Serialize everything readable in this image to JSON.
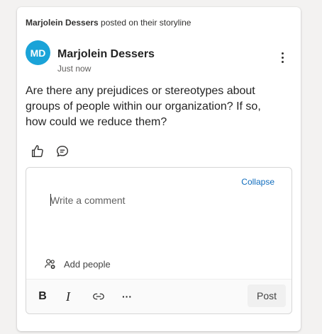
{
  "post": {
    "header_name": "Marjolein Dessers",
    "header_suffix": " posted on their storyline",
    "avatar_initials": "MD",
    "avatar_color": "#1aa3d8",
    "author_name": "Marjolein Dessers",
    "timestamp": "Just now",
    "body": "Are there any prejudices or stereotypes about groups of people within our organization? If so, how could we reduce them?",
    "icons": {
      "more": "more-vertical-icon",
      "like": "thumbs-up-icon",
      "comment": "comment-icon"
    }
  },
  "composer": {
    "collapse_label": "Collapse",
    "placeholder": "Write a comment",
    "add_people_label": "Add people",
    "add_people_icon": "add-people-icon",
    "toolbar": {
      "bold_label": "B",
      "italic_label": "I",
      "link_icon": "link-icon",
      "more_label": "···",
      "post_label": "Post"
    }
  },
  "colors": {
    "accent": "#0f6cbd",
    "card": "#ffffff",
    "background": "#f3f2f1"
  }
}
